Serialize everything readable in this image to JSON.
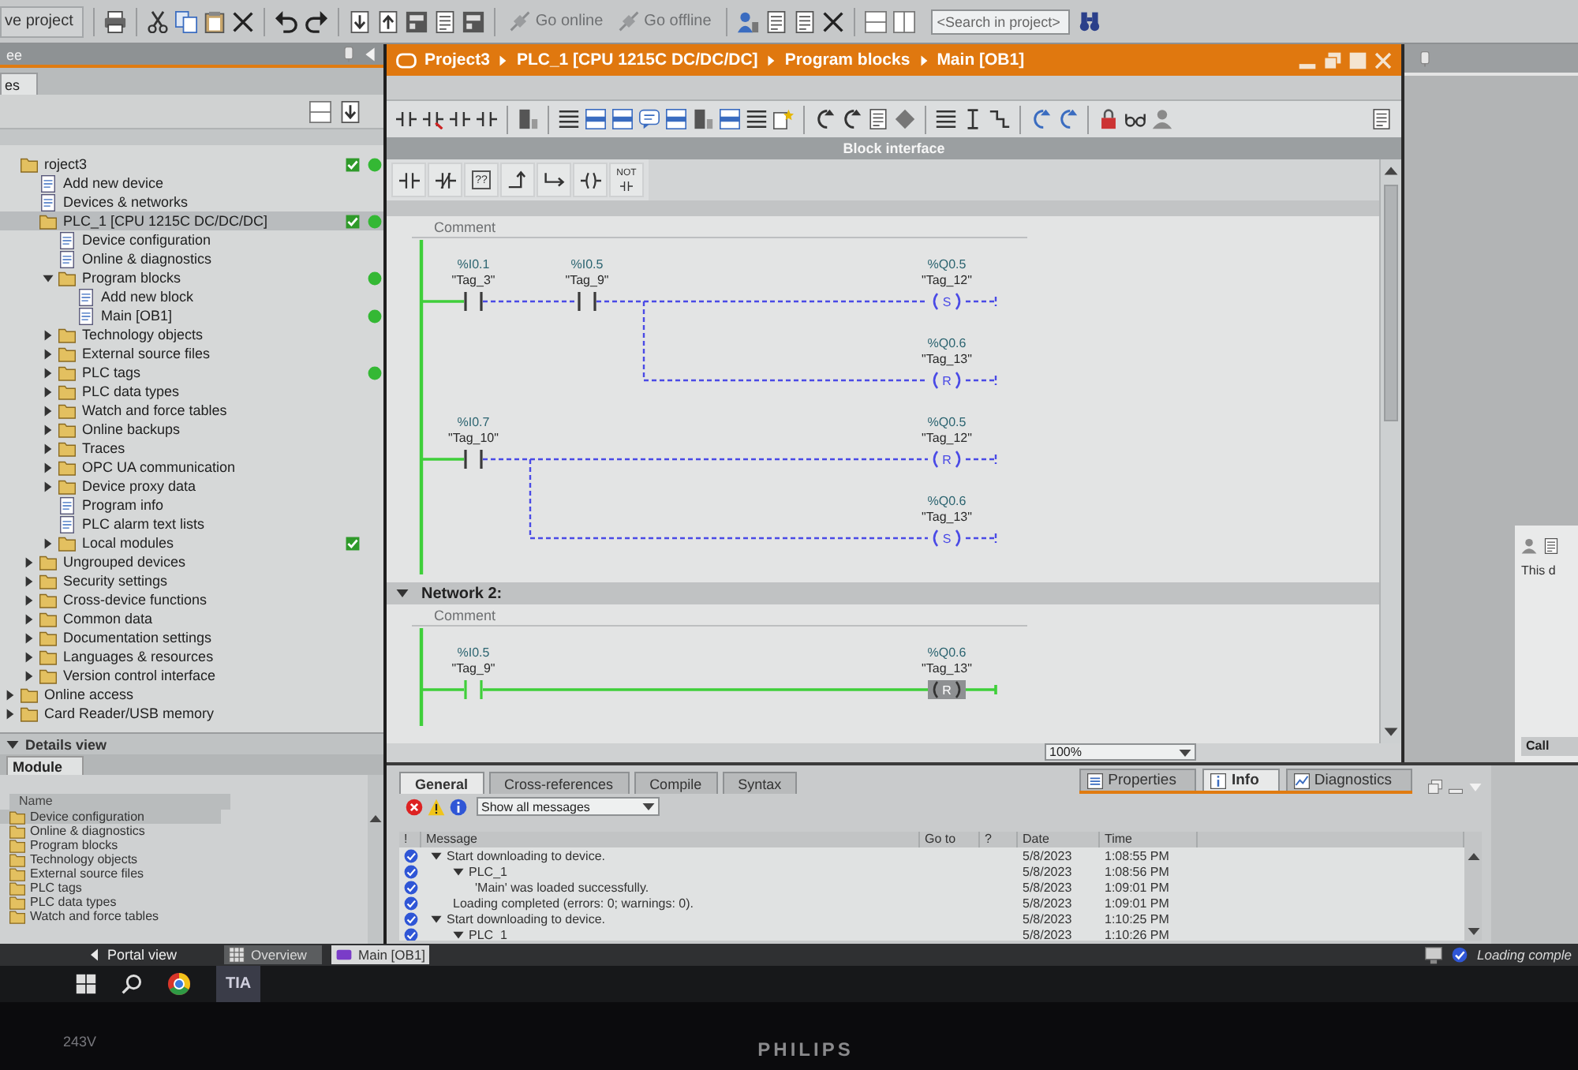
{
  "main_toolbar": {
    "save_label": "ve project",
    "go_online": "Go online",
    "go_offline": "Go offline",
    "search": {
      "placeholder": "<Search in project>"
    }
  },
  "project_tree": {
    "title": "ee",
    "tab": "es",
    "items": [
      {
        "label": "roject3",
        "selected": false,
        "check": true,
        "dot": true,
        "children": [
          {
            "label": "Add new device",
            "selected": false,
            "check": false,
            "dot": false
          },
          {
            "label": "Devices & networks",
            "selected": false,
            "check": false,
            "dot": false
          },
          {
            "label": "PLC_1 [CPU 1215C DC/DC/DC]",
            "selected": true,
            "check": true,
            "dot": true,
            "children": [
              {
                "label": "Device configuration",
                "selected": false,
                "check": false,
                "dot": false
              },
              {
                "label": "Online & diagnostics",
                "selected": false,
                "check": false,
                "dot": false
              },
              {
                "label": "Program blocks",
                "selected": false,
                "check": false,
                "dot": true,
                "expanded": true,
                "children": [
                  {
                    "label": "Add new block",
                    "selected": false,
                    "check": false,
                    "dot": false
                  },
                  {
                    "label": "Main [OB1]",
                    "selected": false,
                    "check": false,
                    "dot": true
                  }
                ]
              },
              {
                "label": "Technology objects",
                "selected": false,
                "check": false,
                "dot": false,
                "expanded": false
              },
              {
                "label": "External source files",
                "selected": false,
                "check": false,
                "dot": false,
                "expanded": false
              },
              {
                "label": "PLC tags",
                "selected": false,
                "check": false,
                "dot": true,
                "expanded": false
              },
              {
                "label": "PLC data types",
                "selected": false,
                "check": false,
                "dot": false,
                "expanded": false
              },
              {
                "label": "Watch and force tables",
                "selected": false,
                "check": false,
                "dot": false,
                "expanded": false
              },
              {
                "label": "Online backups",
                "selected": false,
                "check": false,
                "dot": false,
                "expanded": false
              },
              {
                "label": "Traces",
                "selected": false,
                "check": false,
                "dot": false,
                "expanded": false
              },
              {
                "label": "OPC UA communication",
                "selected": false,
                "check": false,
                "dot": false,
                "expanded": false
              },
              {
                "label": "Device proxy data",
                "selected": false,
                "check": false,
                "dot": false,
                "expanded": false
              },
              {
                "label": "Program info",
                "selected": false,
                "check": false,
                "dot": false
              },
              {
                "label": "PLC alarm text lists",
                "selected": false,
                "check": false,
                "dot": false
              },
              {
                "label": "Local modules",
                "selected": false,
                "check": true,
                "dot": false,
                "expanded": false
              }
            ]
          },
          {
            "label": "Ungrouped devices",
            "selected": false,
            "check": false,
            "dot": false,
            "expanded": false
          },
          {
            "label": "Security settings",
            "selected": false,
            "check": false,
            "dot": false,
            "expanded": false
          },
          {
            "label": "Cross-device functions",
            "selected": false,
            "check": false,
            "dot": false,
            "expanded": false
          },
          {
            "label": "Common data",
            "selected": false,
            "check": false,
            "dot": false,
            "expanded": false
          },
          {
            "label": "Documentation settings",
            "selected": false,
            "check": false,
            "dot": false,
            "expanded": false
          },
          {
            "label": "Languages & resources",
            "selected": false,
            "check": false,
            "dot": false,
            "expanded": false
          },
          {
            "label": "Version control interface",
            "selected": false,
            "check": false,
            "dot": false,
            "expanded": false
          }
        ]
      },
      {
        "label": "Online access",
        "selected": false,
        "check": false,
        "dot": false,
        "expanded": false
      },
      {
        "label": "Card Reader/USB memory",
        "selected": false,
        "check": false,
        "dot": false,
        "expanded": false
      }
    ]
  },
  "details_view": {
    "title": "Details view",
    "tab": "Module",
    "column": "Name",
    "items": [
      {
        "label": "Device configuration",
        "selected": true
      },
      {
        "label": "Online & diagnostics",
        "selected": false
      },
      {
        "label": "Program blocks",
        "selected": false
      },
      {
        "label": "Technology objects",
        "selected": false
      },
      {
        "label": "External source files",
        "selected": false
      },
      {
        "label": "PLC tags",
        "selected": false
      },
      {
        "label": "PLC data types",
        "selected": false
      },
      {
        "label": "Watch and force tables",
        "selected": false
      }
    ]
  },
  "editor": {
    "breadcrumb": [
      "Project3",
      "PLC_1 [CPU 1215C DC/DC/DC]",
      "Program blocks",
      "Main [OB1]"
    ],
    "block_interface": "Block interface",
    "favorites": [
      {
        "kind": "no-contact"
      },
      {
        "kind": "nc-contact"
      },
      {
        "kind": "empty-box",
        "label": "??"
      },
      {
        "kind": "open-branch"
      },
      {
        "kind": "close-branch"
      },
      {
        "kind": "coil"
      },
      {
        "kind": "not",
        "label": "NOT"
      }
    ],
    "networks": [
      {
        "expanded": true,
        "comment": "Comment",
        "rungs": [
          {
            "contacts": [
              {
                "address": "%I0.1",
                "tag": "\"Tag_3\"",
                "closed": false
              },
              {
                "address": "%I0.5",
                "tag": "\"Tag_9\"",
                "closed": false
              }
            ],
            "coils": [
              {
                "address": "%Q0.5",
                "tag": "\"Tag_12\"",
                "operation": "S"
              },
              {
                "address": "%Q0.6",
                "tag": "\"Tag_13\"",
                "operation": "R"
              }
            ]
          },
          {
            "contacts": [
              {
                "address": "%I0.7",
                "tag": "\"Tag_10\"",
                "closed": false
              }
            ],
            "coils": [
              {
                "address": "%Q0.5",
                "tag": "\"Tag_12\"",
                "operation": "R"
              },
              {
                "address": "%Q0.6",
                "tag": "\"Tag_13\"",
                "operation": "S"
              }
            ]
          }
        ]
      },
      {
        "title": "Network 2:",
        "expanded": true,
        "comment": "Comment",
        "rungs": [
          {
            "contacts": [
              {
                "address": "%I0.5",
                "tag": "\"Tag_9\"",
                "closed": true
              }
            ],
            "coils": [
              {
                "address": "%Q0.6",
                "tag": "\"Tag_13\"",
                "operation": "R"
              }
            ]
          }
        ]
      }
    ],
    "zoom": "100%"
  },
  "task_cards": {
    "note": "This d",
    "section": "Call"
  },
  "inspector": {
    "tabs": [
      {
        "label": "Properties",
        "selected": false
      },
      {
        "label": "Info",
        "selected": true
      },
      {
        "label": "Diagnostics",
        "selected": false
      }
    ],
    "subtabs": [
      {
        "label": "General",
        "selected": true
      },
      {
        "label": "Cross-references",
        "selected": false
      },
      {
        "label": "Compile",
        "selected": false
      },
      {
        "label": "Syntax",
        "selected": false
      }
    ],
    "filter": "Show all messages",
    "columns": [
      "!",
      "Message",
      "Go to",
      "?",
      "Date",
      "Time"
    ],
    "rows": [
      {
        "message": "Start downloading to device.",
        "date": "5/8/2023",
        "time": "1:08:55 PM",
        "expanded": true,
        "children": [
          {
            "message": "PLC_1",
            "date": "5/8/2023",
            "time": "1:08:56 PM",
            "expanded": true,
            "children": [
              {
                "message": "'Main' was loaded successfully.",
                "date": "5/8/2023",
                "time": "1:09:01 PM"
              }
            ]
          },
          {
            "message": "Loading completed (errors: 0; warnings: 0).",
            "date": "5/8/2023",
            "time": "1:09:01 PM"
          }
        ]
      },
      {
        "message": "Start downloading to device.",
        "date": "5/8/2023",
        "time": "1:10:25 PM",
        "expanded": true,
        "children": [
          {
            "message": "PLC_1",
            "date": "5/8/2023",
            "time": "1:10:26 PM",
            "expanded": true
          }
        ]
      }
    ]
  },
  "portal_bar": {
    "portal_view": "Portal view",
    "tabs": [
      {
        "label": "Overview",
        "selected": false
      },
      {
        "label": "Main [OB1]",
        "selected": true
      }
    ],
    "status": "Loading comple"
  },
  "taskbar": {
    "app_label": "TIA"
  },
  "monitor": {
    "model": "243V",
    "brand": "PHILIPS"
  }
}
